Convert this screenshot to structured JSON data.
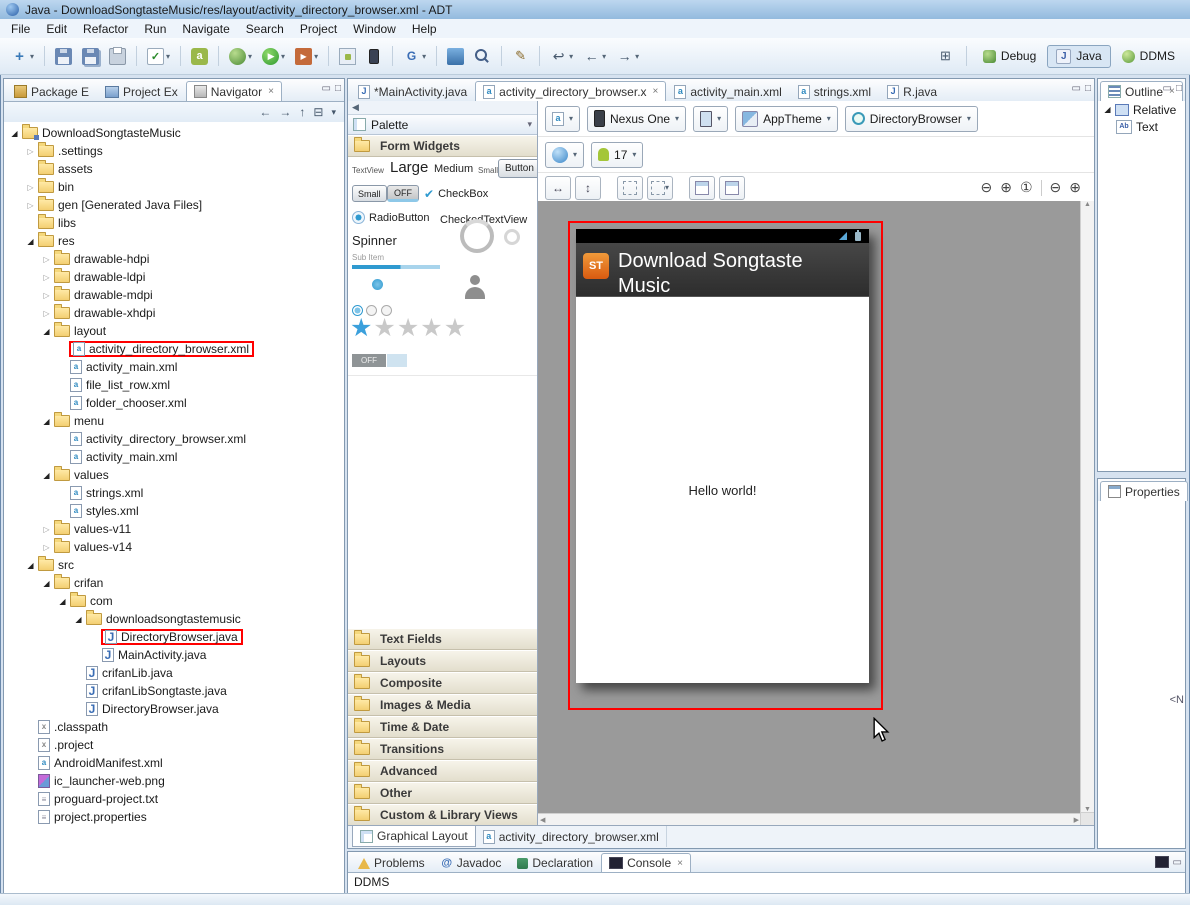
{
  "window": {
    "title": "Java - DownloadSongtasteMusic/res/layout/activity_directory_browser.xml - ADT"
  },
  "menubar": {
    "items": [
      "File",
      "Edit",
      "Refactor",
      "Run",
      "Navigate",
      "Search",
      "Project",
      "Window",
      "Help"
    ]
  },
  "toolbar": {
    "groups": [
      [
        {
          "name": "new-wizard-button",
          "style": "new",
          "glyph": "+",
          "dd": true
        }
      ],
      [
        {
          "name": "save-button",
          "style": "save"
        },
        {
          "name": "save-all-button",
          "style": "saveall"
        },
        {
          "name": "print-button",
          "style": "print"
        }
      ],
      [
        {
          "name": "verify-button",
          "style": "check",
          "glyph": "✓",
          "dd": true
        }
      ],
      [
        {
          "name": "new-android-project-button",
          "style": "android",
          "glyph": "a"
        }
      ],
      [
        {
          "name": "debug-button",
          "style": "debug",
          "dd": true
        },
        {
          "name": "run-button",
          "style": "run",
          "glyph": "▶",
          "dd": true
        },
        {
          "name": "external-tools-button",
          "style": "ext",
          "glyph": "▶",
          "dd": true
        }
      ],
      [
        {
          "name": "sdk-manager-button",
          "style": "sdk"
        },
        {
          "name": "avd-manager-button",
          "style": "avd"
        }
      ],
      [
        {
          "name": "open-resource-button",
          "style": "res",
          "glyph": "G",
          "dd": true
        }
      ],
      [
        {
          "name": "format-button",
          "style": "format"
        },
        {
          "name": "search-button",
          "style": "search"
        }
      ],
      [
        {
          "name": "annotation-button",
          "style": "pencil",
          "glyph": "✎"
        }
      ],
      [
        {
          "name": "last-edit-button",
          "style": "plain",
          "glyph": "↩",
          "dd": true
        },
        {
          "name": "back-button",
          "style": "plain",
          "glyph": "←",
          "dd": true
        },
        {
          "name": "forward-button",
          "style": "plain",
          "glyph": "→",
          "dd": true
        }
      ]
    ],
    "perspectives": [
      {
        "label": "Debug",
        "icon": "debug-perspective"
      },
      {
        "label": "Java",
        "icon": "java-perspective",
        "glyph": "J",
        "active": true
      },
      {
        "label": "DDMS",
        "icon": "ddms-perspective"
      }
    ]
  },
  "left_panel": {
    "tabs": [
      {
        "label": "Package E",
        "icon": "package"
      },
      {
        "label": "Project Ex",
        "icon": "projects"
      },
      {
        "label": "Navigator",
        "icon": "navigator",
        "active": true,
        "closable": true
      }
    ],
    "tree": [
      {
        "label": "DownloadSongtasteMusic",
        "level": 0,
        "arrow": "exp",
        "icon": "project"
      },
      {
        "label": ".settings",
        "level": 1,
        "arrow": "col",
        "icon": "folder"
      },
      {
        "label": "assets",
        "level": 1,
        "arrow": "none",
        "icon": "folder"
      },
      {
        "label": "bin",
        "level": 1,
        "arrow": "col",
        "icon": "folder"
      },
      {
        "label": "gen [Generated Java Files]",
        "level": 1,
        "arrow": "col",
        "icon": "folder"
      },
      {
        "label": "libs",
        "level": 1,
        "arrow": "none",
        "icon": "folder"
      },
      {
        "label": "res",
        "level": 1,
        "arrow": "exp",
        "icon": "folder"
      },
      {
        "label": "drawable-hdpi",
        "level": 2,
        "arrow": "col",
        "icon": "folder"
      },
      {
        "label": "drawable-ldpi",
        "level": 2,
        "arrow": "col",
        "icon": "folder"
      },
      {
        "label": "drawable-mdpi",
        "level": 2,
        "arrow": "col",
        "icon": "folder"
      },
      {
        "label": "drawable-xhdpi",
        "level": 2,
        "arrow": "col",
        "icon": "folder"
      },
      {
        "label": "layout",
        "level": 2,
        "arrow": "exp",
        "icon": "folder"
      },
      {
        "label": "activity_directory_browser.xml",
        "level": 3,
        "arrow": "none",
        "icon": "xml",
        "boxed": true
      },
      {
        "label": "activity_main.xml",
        "level": 3,
        "arrow": "none",
        "icon": "xml"
      },
      {
        "label": "file_list_row.xml",
        "level": 3,
        "arrow": "none",
        "icon": "xml"
      },
      {
        "label": "folder_chooser.xml",
        "level": 3,
        "arrow": "none",
        "icon": "xml"
      },
      {
        "label": "menu",
        "level": 2,
        "arrow": "exp",
        "icon": "folder"
      },
      {
        "label": "activity_directory_browser.xml",
        "level": 3,
        "arrow": "none",
        "icon": "xml"
      },
      {
        "label": "activity_main.xml",
        "level": 3,
        "arrow": "none",
        "icon": "xml"
      },
      {
        "label": "values",
        "level": 2,
        "arrow": "exp",
        "icon": "folder"
      },
      {
        "label": "strings.xml",
        "level": 3,
        "arrow": "none",
        "icon": "xml"
      },
      {
        "label": "styles.xml",
        "level": 3,
        "arrow": "none",
        "icon": "xml"
      },
      {
        "label": "values-v11",
        "level": 2,
        "arrow": "col",
        "icon": "folder"
      },
      {
        "label": "values-v14",
        "level": 2,
        "arrow": "col",
        "icon": "folder"
      },
      {
        "label": "src",
        "level": 1,
        "arrow": "exp",
        "icon": "folder"
      },
      {
        "label": "crifan",
        "level": 2,
        "arrow": "exp",
        "icon": "folder"
      },
      {
        "label": "com",
        "level": 3,
        "arrow": "exp",
        "icon": "folder"
      },
      {
        "label": "downloadsongtastemusic",
        "level": 4,
        "arrow": "exp",
        "icon": "folder"
      },
      {
        "label": "DirectoryBrowser.java",
        "level": 5,
        "arrow": "none",
        "icon": "java",
        "boxed": true
      },
      {
        "label": "MainActivity.java",
        "level": 5,
        "arrow": "none",
        "icon": "java"
      },
      {
        "label": "crifanLib.java",
        "level": 4,
        "arrow": "none",
        "icon": "java"
      },
      {
        "label": "crifanLibSongtaste.java",
        "level": 4,
        "arrow": "none",
        "icon": "java"
      },
      {
        "label": "DirectoryBrowser.java",
        "level": 4,
        "arrow": "none",
        "icon": "java"
      },
      {
        "label": ".classpath",
        "level": 1,
        "arrow": "none",
        "icon": "xfile"
      },
      {
        "label": ".project",
        "level": 1,
        "arrow": "none",
        "icon": "xfile"
      },
      {
        "label": "AndroidManifest.xml",
        "level": 1,
        "arrow": "none",
        "icon": "xml"
      },
      {
        "label": "ic_launcher-web.png",
        "level": 1,
        "arrow": "none",
        "icon": "image"
      },
      {
        "label": "proguard-project.txt",
        "level": 1,
        "arrow": "none",
        "icon": "text"
      },
      {
        "label": "project.properties",
        "level": 1,
        "arrow": "none",
        "icon": "text"
      }
    ]
  },
  "editor": {
    "tabs": [
      {
        "label": "*MainActivity.java",
        "icon": "jfile"
      },
      {
        "label": "activity_directory_browser.x",
        "icon": "afile",
        "active": true,
        "closable": true
      },
      {
        "label": "activity_main.xml",
        "icon": "afile"
      },
      {
        "label": "strings.xml",
        "icon": "afile"
      },
      {
        "label": "R.java",
        "icon": "jfile"
      }
    ],
    "bottom_tabs": [
      {
        "label": "Graphical Layout",
        "icon": "glayout",
        "active": true
      },
      {
        "label": "activity_directory_browser.xml",
        "icon": "afile"
      }
    ]
  },
  "palette": {
    "title": "Palette",
    "sections": [
      "Form Widgets",
      "Text Fields",
      "Layouts",
      "Composite",
      "Images & Media",
      "Time & Date",
      "Transitions",
      "Advanced",
      "Other",
      "Custom & Library Views"
    ],
    "form_widgets": {
      "textview": "TextView",
      "large": "Large",
      "medium": "Medium",
      "small_text": "Small",
      "button": "Button",
      "small_button": "Small",
      "off_toggle": "OFF",
      "checkbox": "CheckBox",
      "radiobutton": "RadioButton",
      "checkedtextview": "CheckedTextView",
      "spinner": "Spinner",
      "sub_item": "Sub Item",
      "toggle_off": "OFF"
    }
  },
  "config_bar": {
    "device": "Nexus One",
    "theme": "AppTheme",
    "activity": "DirectoryBrowser",
    "api_level": "17"
  },
  "preview": {
    "logo": "ST",
    "app_title": "Download Songtaste Music",
    "content_text": "Hello world!"
  },
  "right_panel": {
    "outline_tabs": [
      {
        "label": "Outline",
        "icon": "outline",
        "active": true,
        "closable": true
      }
    ],
    "outline_items": [
      {
        "label": "Relative"
      },
      {
        "label": "Text"
      }
    ],
    "properties_tabs": [
      {
        "label": "Properties",
        "icon": "properties",
        "active": true
      }
    ],
    "clipped_text": "<N"
  },
  "console": {
    "tabs": [
      {
        "label": "Problems",
        "icon": "problems"
      },
      {
        "label": "Javadoc",
        "icon": "javadoc"
      },
      {
        "label": "Declaration",
        "icon": "declaration"
      },
      {
        "label": "Console",
        "icon": "console",
        "active": true,
        "closable": true
      }
    ],
    "content": "DDMS"
  }
}
